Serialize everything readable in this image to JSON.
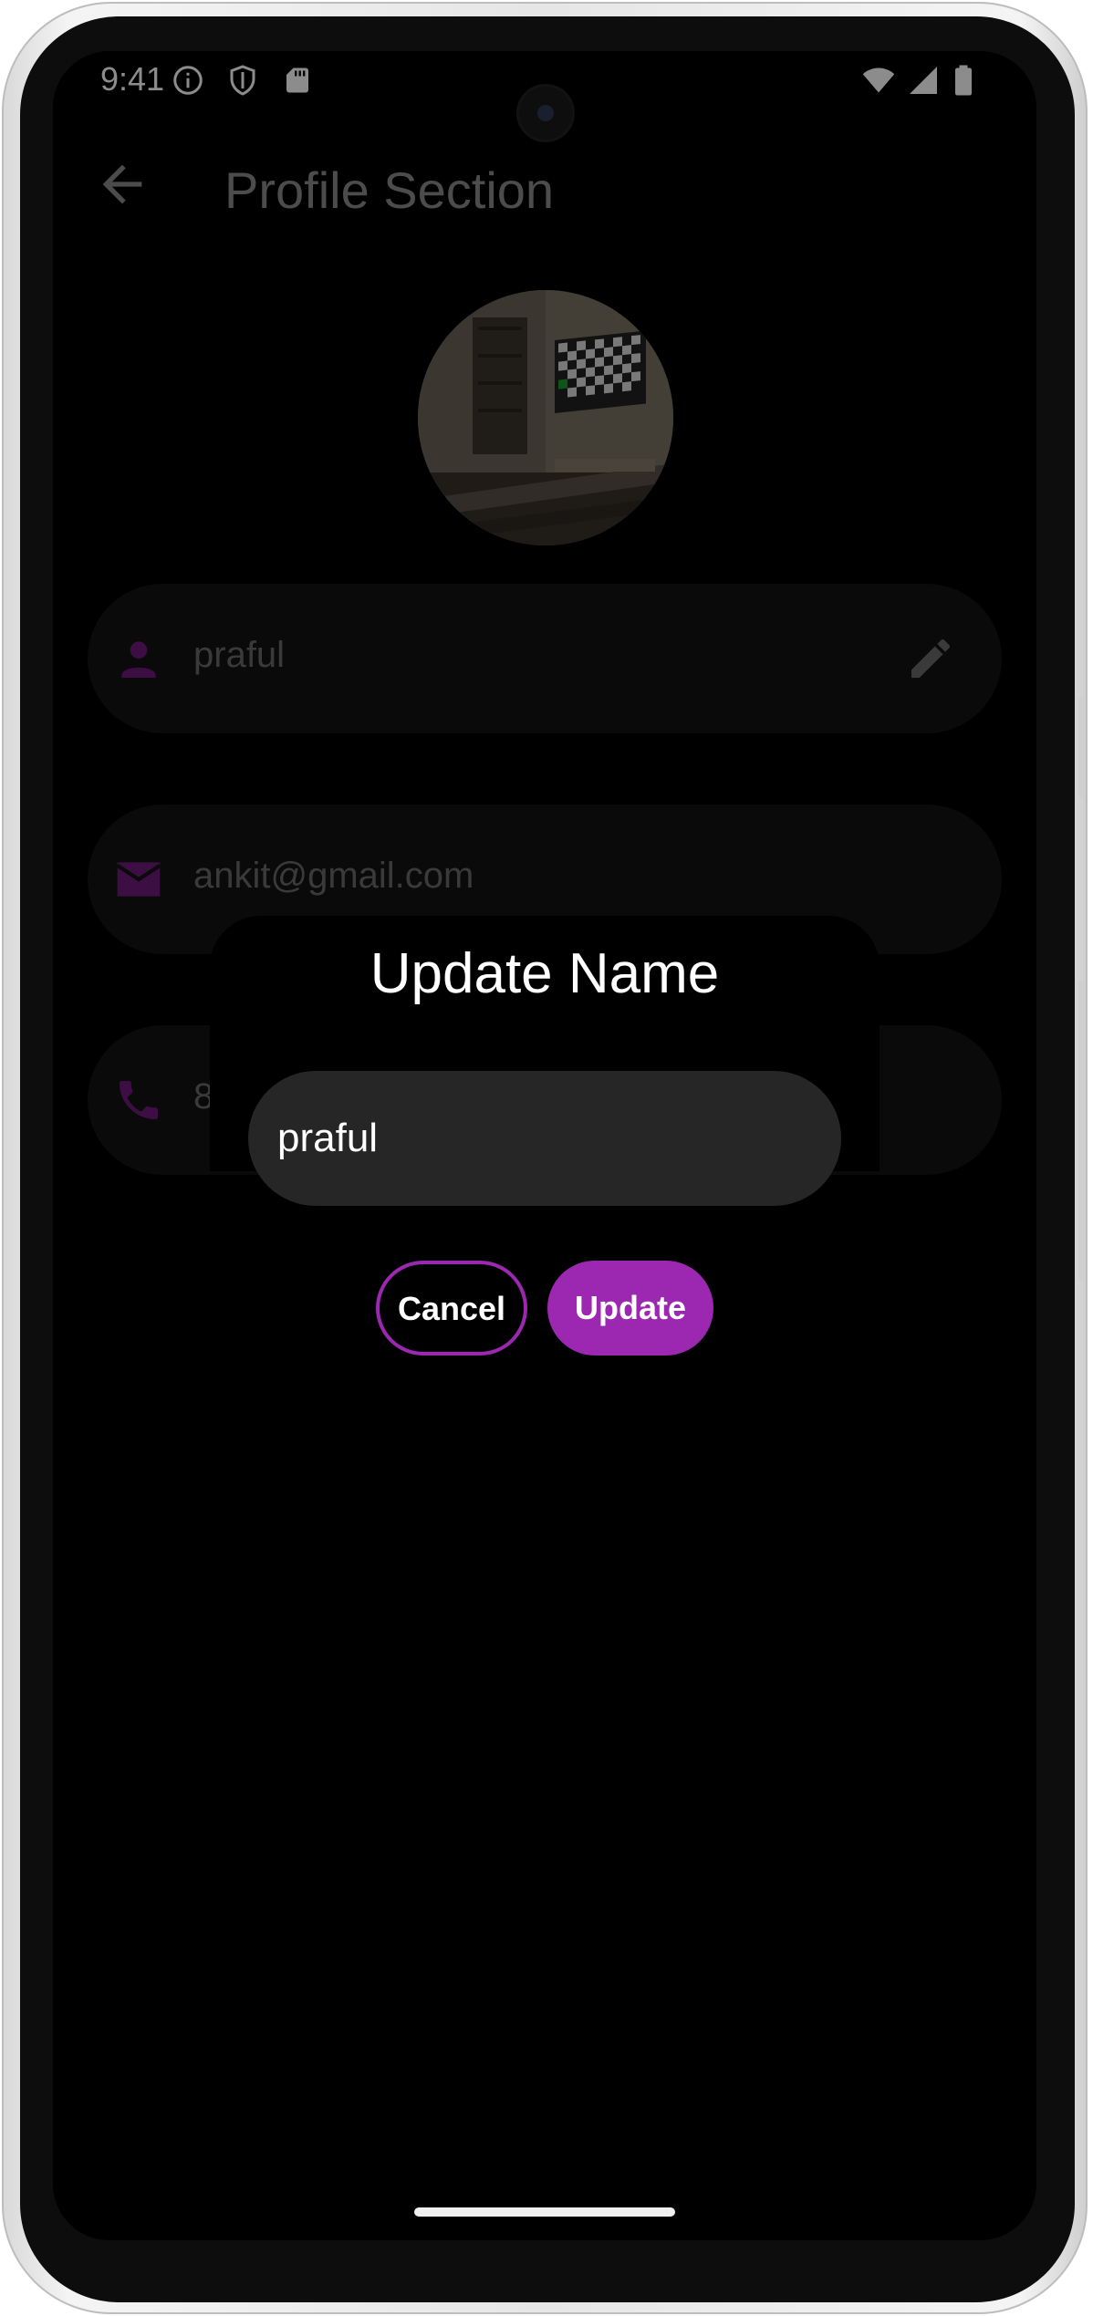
{
  "status_bar": {
    "time": "9:41",
    "left_icons": [
      "info-icon",
      "shield-icon",
      "sd-card-icon"
    ],
    "right_icons": [
      "wifi-icon",
      "signal-icon",
      "battery-icon"
    ]
  },
  "app_bar": {
    "title": "Profile Section",
    "back_icon": "arrow-left-icon"
  },
  "profile": {
    "name_field": {
      "value": "praful",
      "icon": "person-icon",
      "action_icon": "pencil-icon"
    },
    "email_field": {
      "value": "ankit@gmail.com",
      "icon": "mail-icon"
    },
    "phone_field": {
      "value": "8",
      "icon": "phone-icon"
    }
  },
  "dialog": {
    "title": "Update Name",
    "input_value": "praful",
    "cancel_label": "Cancel",
    "update_label": "Update"
  },
  "colors": {
    "accent": "#9c27b0",
    "icon_dim": "#6d1a7b",
    "background": "#000000",
    "field_bg": "#131313",
    "input_bg": "#262626"
  }
}
